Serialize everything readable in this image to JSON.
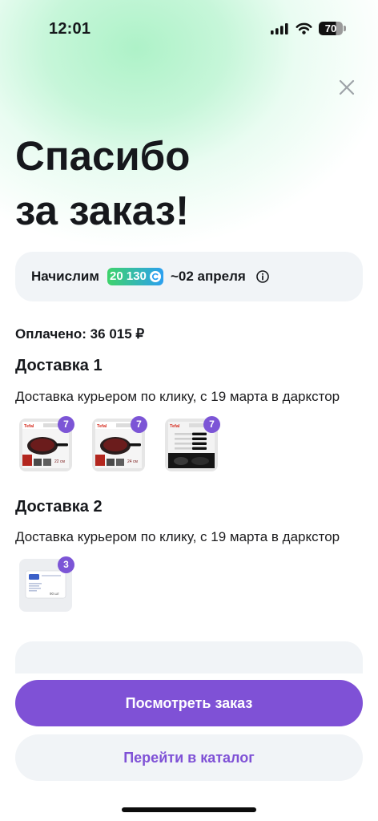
{
  "status_bar": {
    "time": "12:01",
    "battery": "70",
    "icons": [
      "cellular-signal-icon",
      "wifi-icon",
      "battery-icon"
    ]
  },
  "header": {
    "close_icon": "close-icon"
  },
  "title": {
    "line1": "Спасибо",
    "line2": "за заказ!"
  },
  "bonus": {
    "label": "Начислим",
    "amount": "20 130",
    "amount_icon": "coin-icon",
    "date": "~02 апреля",
    "info_icon": "info-icon"
  },
  "payment": {
    "paid": "Оплачено: 36 015 ₽"
  },
  "deliveries": [
    {
      "title": "Доставка 1",
      "description": "Доставка курьером по клику, с 19 марта в даркстор",
      "items": [
        {
          "image": "frying-pan-image",
          "brand": "Tefal",
          "size": "22 см",
          "quantity": "7"
        },
        {
          "image": "frying-pan-image",
          "brand": "Tefal",
          "size": "24 см",
          "quantity": "7"
        },
        {
          "image": "knife-set-image",
          "brand": "Tefal",
          "quantity": "7"
        }
      ]
    },
    {
      "title": "Доставка 2",
      "description": "Доставка курьером по клику, с 19 марта в даркстор",
      "items": [
        {
          "image": "wet-wipes-image",
          "pack_label": "90 шт",
          "quantity": "3"
        }
      ]
    }
  ],
  "actions": {
    "view_order": "Посмотреть заказ",
    "go_to_catalog": "Перейти в каталог"
  },
  "colors": {
    "accent": "#7f51d6",
    "surface": "#f1f4f7",
    "text": "#16181c",
    "bonus_gradient_start": "#3fd36b",
    "bonus_gradient_end": "#2b9ff0",
    "header_glow": "#aef2c8",
    "close_icon": "#9ea3a8",
    "quantity_badge": "#7c55d6"
  }
}
